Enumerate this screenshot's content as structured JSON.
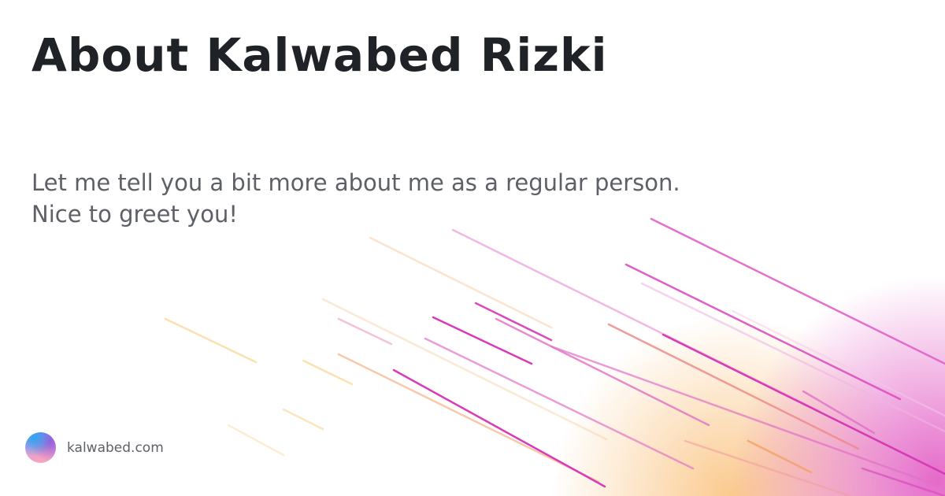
{
  "title": "About Kalwabed Rizki",
  "subtitle_lines": [
    "Let me tell you a bit more about me as a regular person.",
    "Nice to greet you!"
  ],
  "brand": {
    "site": "kalwabed.com",
    "logo_icon": "gradient-circle-logo"
  },
  "colors": {
    "title": "#1f2226",
    "text": "#5d6067",
    "accent_pink": "#e03fbf",
    "accent_orange": "#f5a55a"
  }
}
